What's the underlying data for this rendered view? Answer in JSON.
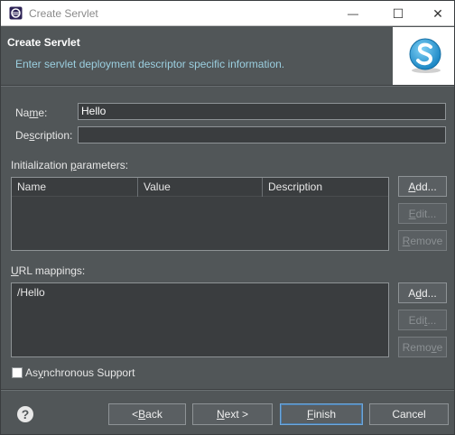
{
  "window": {
    "title": "Create Servlet",
    "minimize_glyph": "—",
    "maximize_glyph": "☐",
    "close_glyph": "✕"
  },
  "banner": {
    "heading": "Create Servlet",
    "description": "Enter servlet deployment descriptor specific information."
  },
  "form": {
    "name_label_pre": "Na",
    "name_label_mn": "m",
    "name_label_post": "e:",
    "name_value": "Hello",
    "description_label_pre": "De",
    "description_label_mn": "s",
    "description_label_post": "cription:",
    "description_value": ""
  },
  "init_params": {
    "label_pre": "Initialization ",
    "label_mn": "p",
    "label_post": "arameters:",
    "columns": [
      "Name",
      "Value",
      "Description"
    ],
    "rows": [],
    "add_pre": "",
    "add_mn": "A",
    "add_post": "dd...",
    "edit_pre": "",
    "edit_mn": "E",
    "edit_post": "dit...",
    "remove_pre": "",
    "remove_mn": "R",
    "remove_post": "emove"
  },
  "url_mappings": {
    "label_pre": "",
    "label_mn": "U",
    "label_post": "RL mappings:",
    "items": [
      "/Hello"
    ],
    "add_pre": "A",
    "add_mn": "d",
    "add_post": "d...",
    "edit_pre": "Edi",
    "edit_mn": "t",
    "edit_post": "...",
    "remove_pre": "Remo",
    "remove_mn": "v",
    "remove_post": "e"
  },
  "async": {
    "label_pre": "As",
    "label_mn": "y",
    "label_post": "nchronous Support",
    "checked": false
  },
  "footer": {
    "help_glyph": "?",
    "back_pre": "< ",
    "back_mn": "B",
    "back_post": "ack",
    "next_pre": "",
    "next_mn": "N",
    "next_post": "ext >",
    "finish_pre": "",
    "finish_mn": "F",
    "finish_post": "inish",
    "cancel_label": "Cancel"
  },
  "colors": {
    "background": "#515658",
    "field": "#3a3d3f",
    "accent_text": "#9bcfe0",
    "logo_blue": "#2a9fd8"
  },
  "icons": {
    "app": "eclipse-icon",
    "logo": "servlet-logo-icon",
    "help": "help-icon"
  }
}
